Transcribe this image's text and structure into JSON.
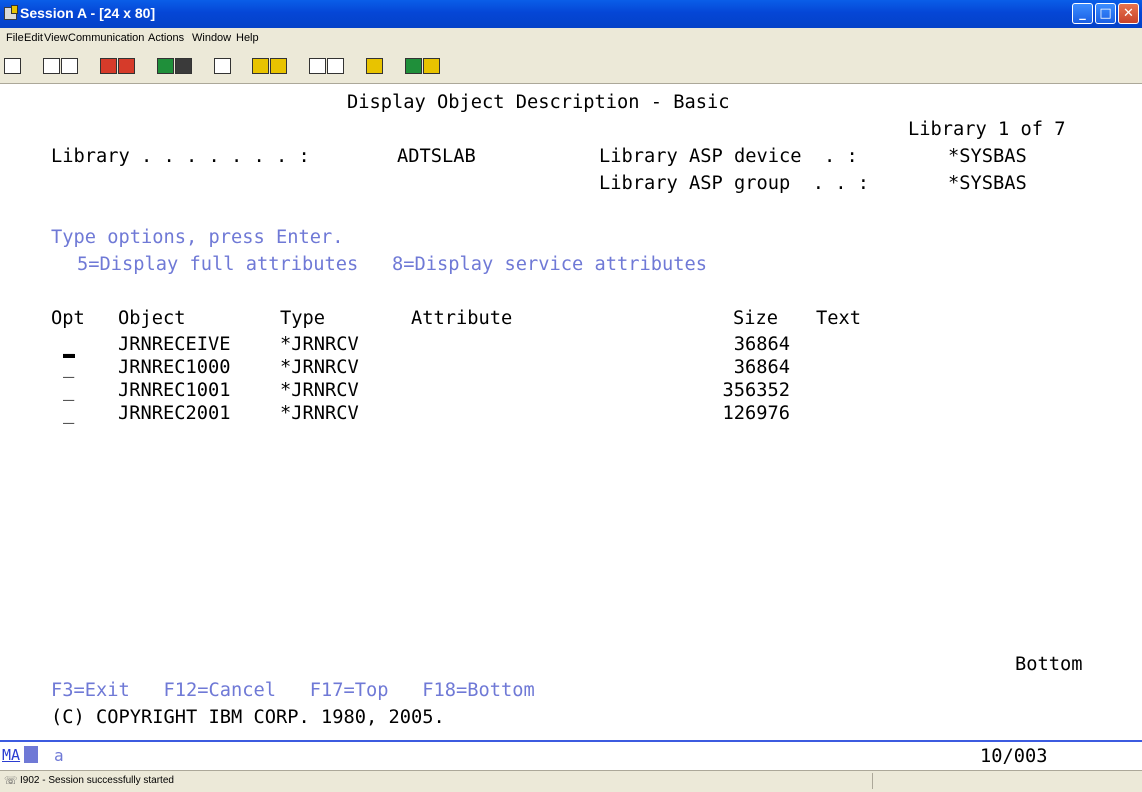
{
  "window": {
    "title": "Session A - [24 x 80]"
  },
  "menu": [
    "File",
    "Edit",
    "View",
    "Communication",
    "Actions",
    "Window",
    "Help"
  ],
  "screen": {
    "heading": "Display Object Description - Basic",
    "position": "Library 1 of 7",
    "library_label": "Library . . . . . . . :",
    "library_value": "ADTSLAB",
    "asp_device_label": "Library ASP device  . :",
    "asp_device_value": "*SYSBAS",
    "asp_group_label": "Library ASP group  . . :",
    "asp_group_value": "*SYSBAS",
    "instructions": "Type options, press Enter.",
    "options": "5=Display full attributes   8=Display service attributes",
    "columns": {
      "opt": "Opt",
      "object": "Object",
      "type": "Type",
      "attribute": "Attribute",
      "size": "Size",
      "text": "Text"
    },
    "rows": [
      {
        "opt": "_",
        "object": "JRNRECEIVE",
        "type": "*JRNRCV",
        "attribute": "",
        "size": "36864",
        "text": ""
      },
      {
        "opt": "_",
        "object": "JRNREC1000",
        "type": "*JRNRCV",
        "attribute": "",
        "size": "36864",
        "text": ""
      },
      {
        "opt": "_",
        "object": "JRNREC1001",
        "type": "*JRNRCV",
        "attribute": "",
        "size": "356352",
        "text": ""
      },
      {
        "opt": "_",
        "object": "JRNREC2001",
        "type": "*JRNRCV",
        "attribute": "",
        "size": "126976",
        "text": ""
      }
    ],
    "more": "Bottom",
    "fkeys": "F3=Exit   F12=Cancel   F17=Top   F18=Bottom",
    "copyright": "(C) COPYRIGHT IBM CORP. 1980, 2005."
  },
  "status": {
    "indicator": "MA",
    "input_mode": "a",
    "cursor_position": "10/003"
  },
  "message_bar": {
    "text": "I902 - Session successfully started"
  },
  "toolbar_icons": [
    "print-screen-icon",
    "copy-icon",
    "paste-icon",
    "send-file-icon",
    "receive-file-icon",
    "display-icon",
    "black-display-icon",
    "macro-icon",
    "record-macro-icon",
    "play-macro-icon",
    "keyboard-map-icon",
    "color-map-icon",
    "clipboard-icon",
    "globe-icon",
    "help-icon"
  ]
}
